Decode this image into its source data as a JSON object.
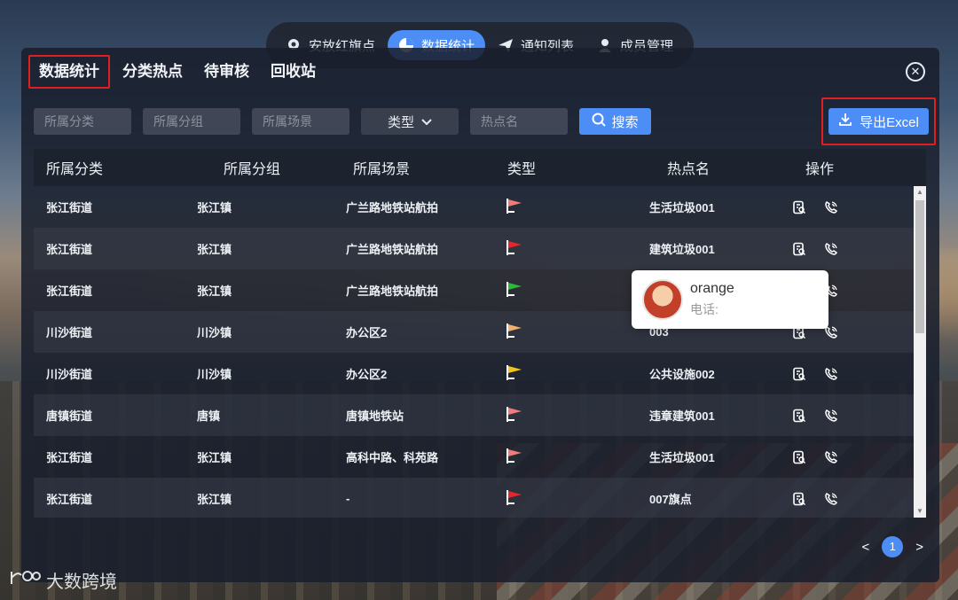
{
  "topnav": {
    "items": [
      {
        "label": "安放红旗点",
        "icon": "pin-icon",
        "active": false
      },
      {
        "label": "数据统计",
        "icon": "pie-chart-icon",
        "active": true
      },
      {
        "label": "通知列表",
        "icon": "paper-plane-icon",
        "active": false
      },
      {
        "label": "成员管理",
        "icon": "user-icon",
        "active": false
      }
    ]
  },
  "tabs": [
    "数据统计",
    "分类热点",
    "待审核",
    "回收站"
  ],
  "filters": {
    "category_placeholder": "所属分类",
    "group_placeholder": "所属分组",
    "scene_placeholder": "所属场景",
    "type_label": "类型",
    "hotspot_placeholder": "热点名",
    "search_label": "搜索",
    "export_label": "导出Excel"
  },
  "table": {
    "headers": [
      "所属分类",
      "所属分组",
      "所属场景",
      "类型",
      "热点名",
      "操作"
    ],
    "rows": [
      {
        "category": "张江街道",
        "group": "张江镇",
        "scene": "广兰路地铁站航拍",
        "flag_color": "#f07b7b",
        "name": "生活垃圾001"
      },
      {
        "category": "张江街道",
        "group": "张江镇",
        "scene": "广兰路地铁站航拍",
        "flag_color": "#e8252a",
        "name": "建筑垃圾001"
      },
      {
        "category": "张江街道",
        "group": "张江镇",
        "scene": "广兰路地铁站航拍",
        "flag_color": "#2fb83a",
        "name": ""
      },
      {
        "category": "川沙街道",
        "group": "川沙镇",
        "scene": "办公区2",
        "flag_color": "#f2b06a",
        "name": "003"
      },
      {
        "category": "川沙街道",
        "group": "川沙镇",
        "scene": "办公区2",
        "flag_color": "#f0c419",
        "name": "公共设施002"
      },
      {
        "category": "唐镇街道",
        "group": "唐镇",
        "scene": "唐镇地铁站",
        "flag_color": "#f07b7b",
        "name": "违章建筑001"
      },
      {
        "category": "张江街道",
        "group": "张江镇",
        "scene": "高科中路、科苑路",
        "flag_color": "#f07b7b",
        "name": "生活垃圾001"
      },
      {
        "category": "张江街道",
        "group": "张江镇",
        "scene": "-",
        "flag_color": "#e8252a",
        "name": "007旗点"
      }
    ]
  },
  "pager": {
    "prev": "<",
    "current": "1",
    "next": ">"
  },
  "popup": {
    "name": "orange",
    "phone_label": "电话:"
  },
  "watermark": "大数跨境",
  "colors": {
    "accent": "#4d8df6",
    "highlight_border": "#e02020"
  }
}
